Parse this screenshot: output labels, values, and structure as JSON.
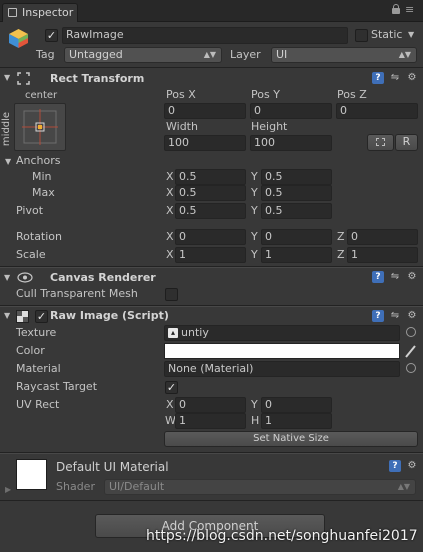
{
  "tab": {
    "label": "Inspector"
  },
  "window_icons": {
    "lock": "lock-icon",
    "menu": "menu-icon"
  },
  "object": {
    "name": "RawImage",
    "active": true,
    "static_label": "Static",
    "tag_label": "Tag",
    "tag_value": "Untagged",
    "layer_label": "Layer",
    "layer_value": "UI"
  },
  "rect_transform": {
    "title": "Rect Transform",
    "anchor_top_label": "center",
    "anchor_side_label": "middle",
    "pos_x_label": "Pos X",
    "pos_y_label": "Pos Y",
    "pos_z_label": "Pos Z",
    "pos_x": "0",
    "pos_y": "0",
    "pos_z": "0",
    "width_label": "Width",
    "height_label": "Height",
    "width": "100",
    "height": "100",
    "r_button": "R",
    "anchors_label": "Anchors",
    "min_label": "Min",
    "max_label": "Max",
    "pivot_label": "Pivot",
    "min_x": "0.5",
    "min_y": "0.5",
    "max_x": "0.5",
    "max_y": "0.5",
    "pivot_x": "0.5",
    "pivot_y": "0.5",
    "rotation_label": "Rotation",
    "scale_label": "Scale",
    "rot_x": "0",
    "rot_y": "0",
    "rot_z": "0",
    "scale_x": "1",
    "scale_y": "1",
    "scale_z": "1",
    "x": "X",
    "y": "Y",
    "z": "Z"
  },
  "canvas_renderer": {
    "title": "Canvas Renderer",
    "cull_label": "Cull Transparent Mesh",
    "cull_checked": false
  },
  "raw_image": {
    "title": "Raw Image (Script)",
    "enabled": true,
    "texture_label": "Texture",
    "texture_value": "untiy",
    "color_label": "Color",
    "color_value": "#ffffff",
    "material_label": "Material",
    "material_value": "None (Material)",
    "raycast_label": "Raycast Target",
    "raycast_checked": true,
    "uvrect_label": "UV Rect",
    "uv_x": "0",
    "uv_y": "0",
    "uv_w": "1",
    "uv_h": "1",
    "w": "W",
    "h": "H",
    "native_size_button": "Set Native Size"
  },
  "material_section": {
    "title": "Default UI Material",
    "shader_label": "Shader",
    "shader_value": "UI/Default"
  },
  "add_component_button": "Add Component",
  "watermark": "https://blog.csdn.net/songhuanfei2017"
}
